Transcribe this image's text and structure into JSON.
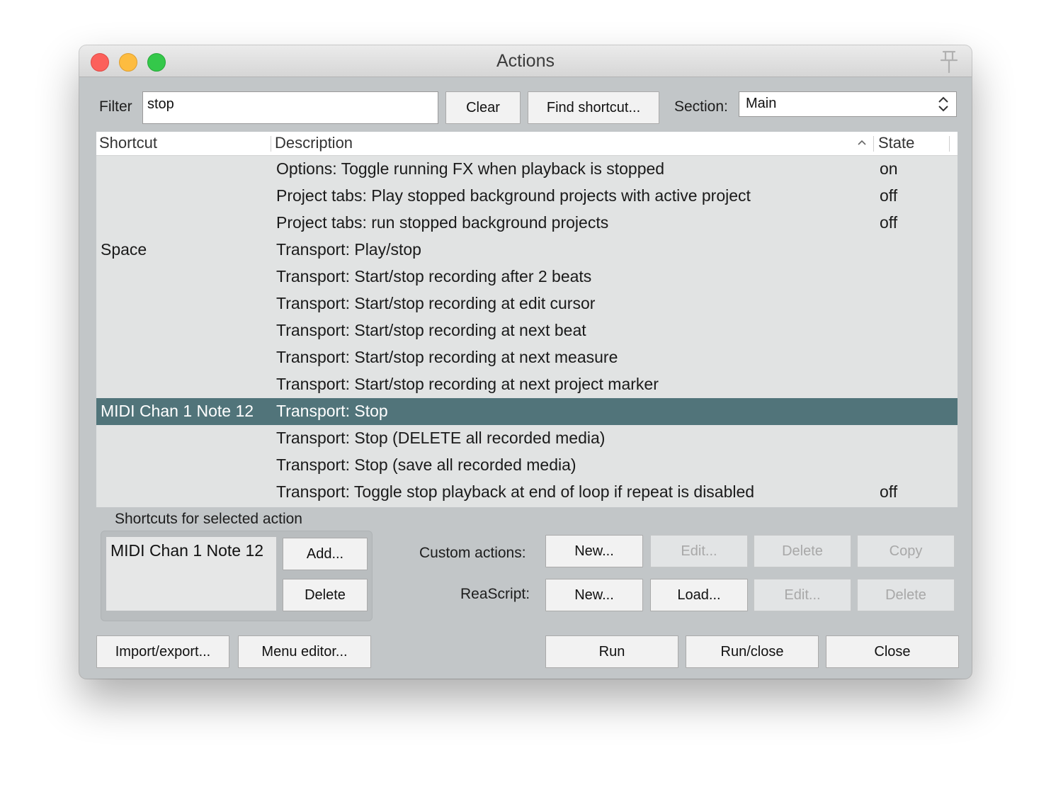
{
  "window": {
    "title": "Actions"
  },
  "filter": {
    "label": "Filter",
    "value": "stop"
  },
  "toolbar": {
    "clear_label": "Clear",
    "find_shortcut_label": "Find shortcut...",
    "section_label": "Section:",
    "section_value": "Main"
  },
  "table": {
    "columns": [
      "Shortcut",
      "Description",
      "State"
    ],
    "rows": [
      {
        "shortcut": "",
        "description": "Options: Toggle running FX when playback is stopped",
        "state": "on"
      },
      {
        "shortcut": "",
        "description": "Project tabs: Play stopped background projects with active project",
        "state": "off"
      },
      {
        "shortcut": "",
        "description": "Project tabs: run stopped background projects",
        "state": "off"
      },
      {
        "shortcut": "Space",
        "description": "Transport: Play/stop",
        "state": ""
      },
      {
        "shortcut": "",
        "description": "Transport: Start/stop recording after 2 beats",
        "state": ""
      },
      {
        "shortcut": "",
        "description": "Transport: Start/stop recording at edit cursor",
        "state": ""
      },
      {
        "shortcut": "",
        "description": "Transport: Start/stop recording at next beat",
        "state": ""
      },
      {
        "shortcut": "",
        "description": "Transport: Start/stop recording at next measure",
        "state": ""
      },
      {
        "shortcut": "",
        "description": "Transport: Start/stop recording at next project marker",
        "state": ""
      },
      {
        "shortcut": "MIDI Chan 1 Note 12",
        "description": "Transport: Stop",
        "state": "",
        "selected": true
      },
      {
        "shortcut": "",
        "description": "Transport: Stop (DELETE all recorded media)",
        "state": ""
      },
      {
        "shortcut": "",
        "description": "Transport: Stop (save all recorded media)",
        "state": ""
      },
      {
        "shortcut": "",
        "description": "Transport: Toggle stop playback at end of loop if repeat is disabled",
        "state": "off"
      }
    ]
  },
  "shortcuts_panel": {
    "title": "Shortcuts for selected action",
    "items": [
      "MIDI Chan 1 Note 12"
    ],
    "add_label": "Add...",
    "delete_label": "Delete"
  },
  "custom_actions": {
    "label": "Custom actions:",
    "new_label": "New...",
    "edit_label": "Edit...",
    "delete_label": "Delete",
    "copy_label": "Copy"
  },
  "reascript": {
    "label": "ReaScript:",
    "new_label": "New...",
    "load_label": "Load...",
    "edit_label": "Edit...",
    "delete_label": "Delete"
  },
  "footer": {
    "import_export_label": "Import/export...",
    "menu_editor_label": "Menu editor...",
    "run_label": "Run",
    "run_close_label": "Run/close",
    "close_label": "Close"
  },
  "colors": {
    "selected_row": "#51747a",
    "window_bg": "#c2c6c8"
  }
}
